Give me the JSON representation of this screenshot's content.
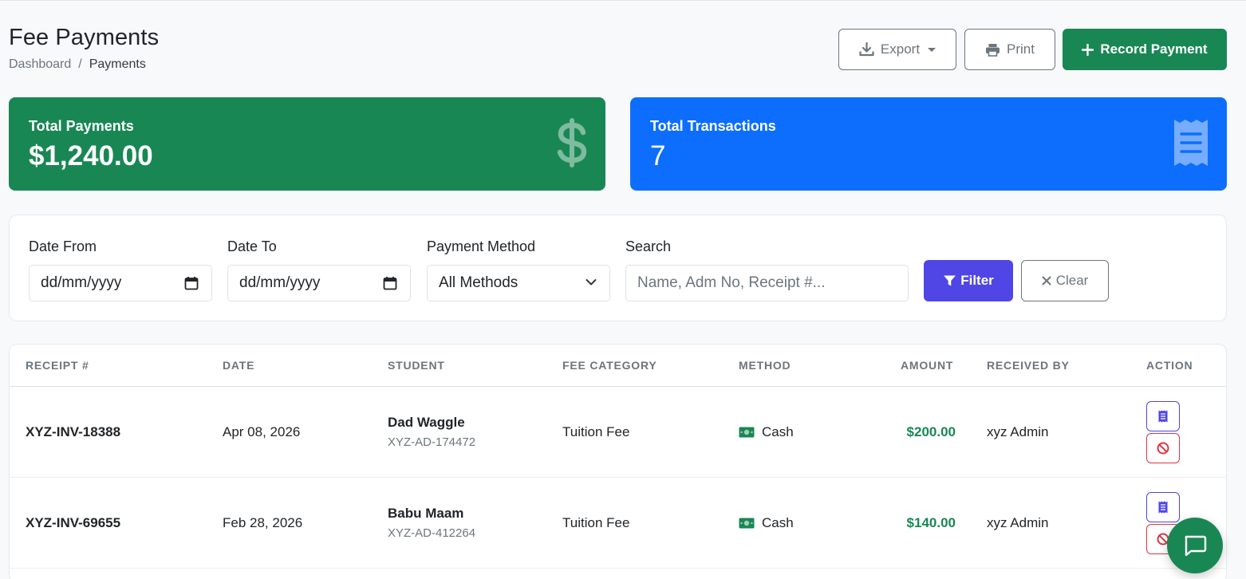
{
  "header": {
    "title": "Fee Payments",
    "breadcrumb": {
      "home": "Dashboard",
      "separator": "/",
      "current": "Payments"
    },
    "export_label": "Export",
    "print_label": "Print",
    "record_label": "Record Payment"
  },
  "stats": {
    "total_payments_label": "Total Payments",
    "total_payments_value": "$1,240.00",
    "total_transactions_label": "Total Transactions",
    "total_transactions_value": "7"
  },
  "filters": {
    "date_from_label": "Date From",
    "date_from_value": "dd/mm/yyyy",
    "date_to_label": "Date To",
    "date_to_value": "dd/mm/yyyy",
    "method_label": "Payment Method",
    "method_value": "All Methods",
    "search_label": "Search",
    "search_placeholder": "Name, Adm No, Receipt #...",
    "filter_label": "Filter",
    "clear_label": "Clear"
  },
  "table": {
    "columns": [
      "RECEIPT #",
      "DATE",
      "STUDENT",
      "FEE CATEGORY",
      "METHOD",
      "AMOUNT",
      "RECEIVED BY",
      "ACTION"
    ],
    "rows": [
      {
        "receipt": "XYZ-INV-18388",
        "date": "Apr 08, 2026",
        "student": "Dad Waggle",
        "student_id": "XYZ-AD-174472",
        "category": "Tuition Fee",
        "method": "Cash",
        "amount": "$200.00",
        "received_by": "xyz Admin"
      },
      {
        "receipt": "XYZ-INV-69655",
        "date": "Feb 28, 2026",
        "student": "Babu Maam",
        "student_id": "XYZ-AD-412264",
        "category": "Tuition Fee",
        "method": "Cash",
        "amount": "$140.00",
        "received_by": "xyz Admin"
      }
    ]
  },
  "colors": {
    "success": "#198754",
    "primary": "#0d6efd",
    "indigo": "#4f46e5",
    "danger": "#dc3545"
  },
  "icons": {
    "export": "download-icon",
    "print": "printer-icon",
    "record": "plus-icon",
    "payments": "dollar-icon",
    "transactions": "receipt-icon",
    "filter": "funnel-icon",
    "clear": "x-icon",
    "method": "cash-icon",
    "view": "receipt-icon",
    "void": "ban-icon",
    "chat": "chat-icon"
  }
}
